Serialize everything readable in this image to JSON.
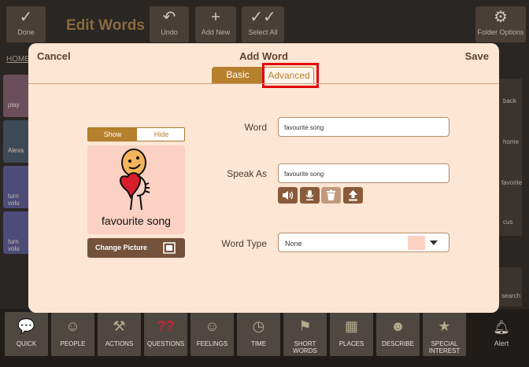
{
  "toolbar": {
    "done_label": "Done",
    "title": "Edit Words",
    "undo_label": "Undo",
    "add_new_label": "Add New",
    "select_all_label": "Select All",
    "folder_options_label": "Folder Options"
  },
  "breadcrumb": {
    "home": "HOME"
  },
  "left_tiles": [
    "play",
    "Alexa",
    "turn volu",
    "turn volu"
  ],
  "right_tiles": [
    "back",
    "home",
    "favorite",
    "cus",
    "",
    "search"
  ],
  "categories": [
    "QUICK",
    "PEOPLE",
    "ACTIONS",
    "QUESTIONS",
    "FEELINGS",
    "TIME",
    "SHORT WORDS",
    "PLACES",
    "DESCRIBE",
    "SPECIAL INTEREST"
  ],
  "alert_label": "Alert",
  "modal": {
    "title": "Add Word",
    "cancel_label": "Cancel",
    "save_label": "Save",
    "tabs": {
      "basic": "Basic",
      "advanced": "Advanced"
    },
    "active_tab": "Basic",
    "picture": {
      "show_label": "Show",
      "hide_label": "Hide",
      "caption": "favourite song",
      "change_label": "Change Picture"
    },
    "form": {
      "word_label": "Word",
      "word_value": "favourite song",
      "speak_as_label": "Speak As",
      "speak_as_value": "favourite song",
      "word_type_label": "Word Type",
      "word_type_value": "None",
      "word_type_color": "#fbd1c4"
    },
    "audio_buttons": [
      "speaker-icon",
      "microphone-icon",
      "trash-icon",
      "upload-icon"
    ]
  },
  "colors": {
    "accent": "#b6802c",
    "modal_bg": "#fde6d4",
    "button_brown": "#74513a",
    "highlight": "#e3000f"
  }
}
